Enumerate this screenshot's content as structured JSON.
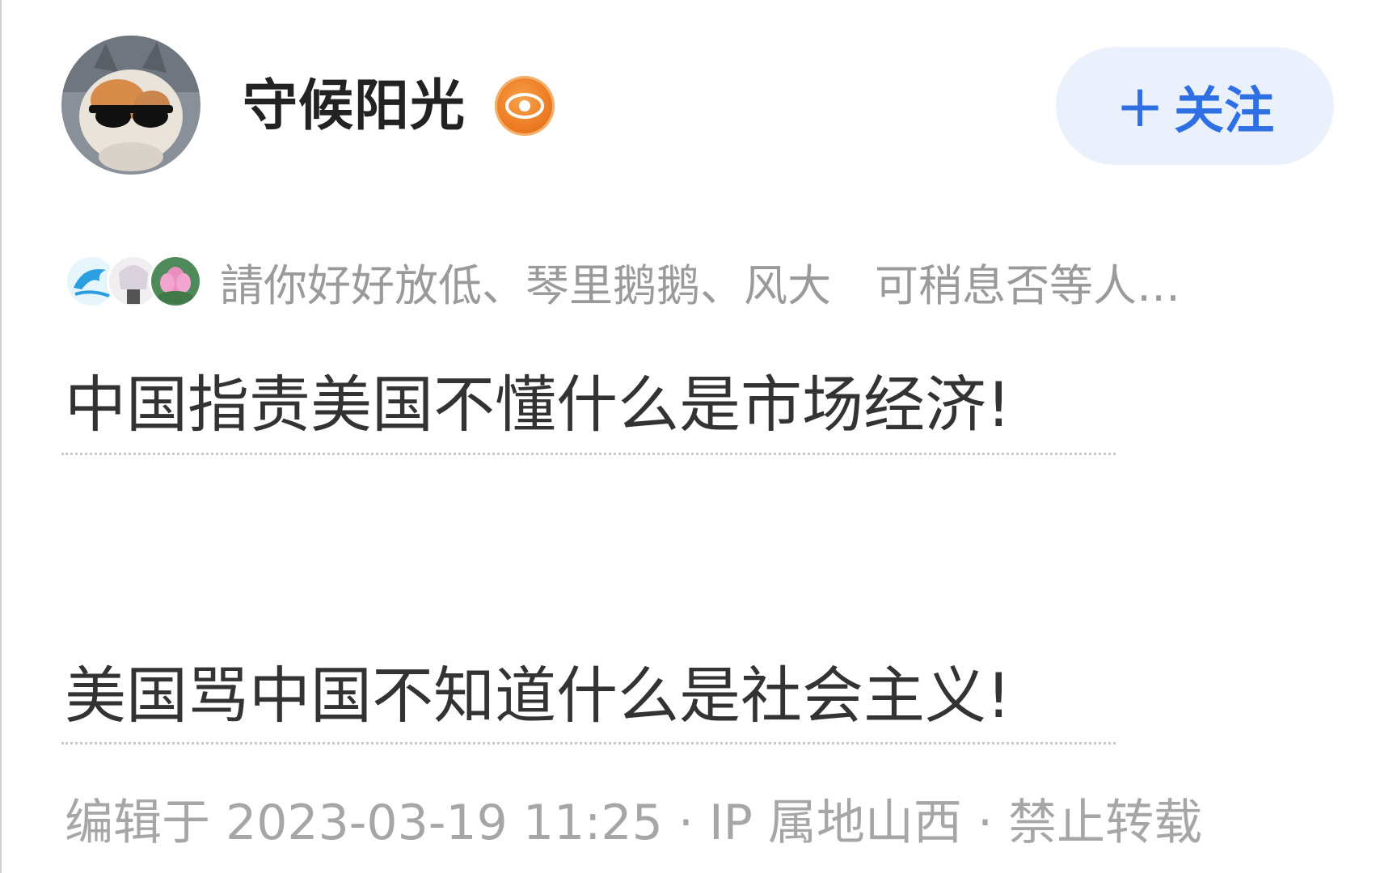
{
  "author": {
    "name": "守候阳光",
    "badge_icon": "verified-badge-icon",
    "badge_color": "#ec7a22"
  },
  "follow_button": {
    "plus": "+",
    "label": "关注",
    "color": "#2f6fe4"
  },
  "likers": {
    "text": "請你好好放低、琴里鹅鹅、风大　可稍息否等人…"
  },
  "post": {
    "lines": [
      "中国指责美国不懂什么是市场经济!",
      "美国骂中国不知道什么是社会主义!"
    ]
  },
  "meta": {
    "text": "编辑于 2023-03-19 11:25 · IP 属地山西 · 禁止转载"
  }
}
